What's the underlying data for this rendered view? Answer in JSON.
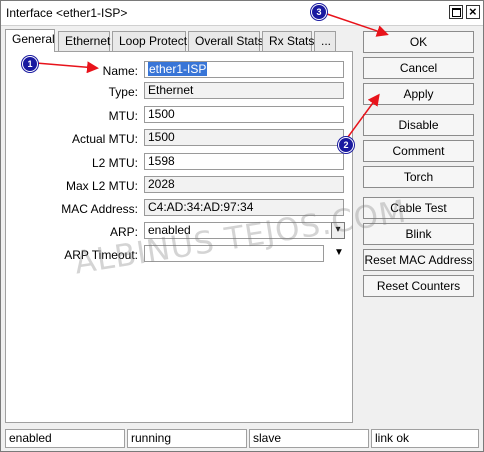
{
  "window": {
    "title": "Interface <ether1-ISP>"
  },
  "tabs": [
    {
      "label": "General"
    },
    {
      "label": "Ethernet"
    },
    {
      "label": "Loop Protect"
    },
    {
      "label": "Overall Stats"
    },
    {
      "label": "Rx Stats"
    },
    {
      "label": "..."
    }
  ],
  "form": {
    "name": {
      "label": "Name:",
      "value": "ether1-ISP"
    },
    "type": {
      "label": "Type:",
      "value": "Ethernet"
    },
    "mtu": {
      "label": "MTU:",
      "value": "1500"
    },
    "actual_mtu": {
      "label": "Actual MTU:",
      "value": "1500"
    },
    "l2_mtu": {
      "label": "L2 MTU:",
      "value": "1598"
    },
    "max_l2_mtu": {
      "label": "Max L2 MTU:",
      "value": "2028"
    },
    "mac": {
      "label": "MAC Address:",
      "value": "C4:AD:34:AD:97:34"
    },
    "arp": {
      "label": "ARP:",
      "value": "enabled"
    },
    "arp_timeout": {
      "label": "ARP Timeout:",
      "value": ""
    }
  },
  "buttons": {
    "ok": "OK",
    "cancel": "Cancel",
    "apply": "Apply",
    "disable": "Disable",
    "comment": "Comment",
    "torch": "Torch",
    "cable_test": "Cable Test",
    "blink": "Blink",
    "reset_mac": "Reset MAC Address",
    "reset_counters": "Reset Counters"
  },
  "status": [
    "enabled",
    "running",
    "slave",
    "link ok"
  ],
  "watermark": "ALBINUS TEJOS.COM",
  "markers": [
    "1",
    "2",
    "3"
  ],
  "colors": {
    "annotation_arrow": "#e8131b",
    "marker": "#1a1aa0",
    "selection": "#3875d7"
  },
  "icons": {
    "maximize": "maximize-icon",
    "close": "close-icon",
    "dropdown": "dropdown-arrow-icon"
  }
}
